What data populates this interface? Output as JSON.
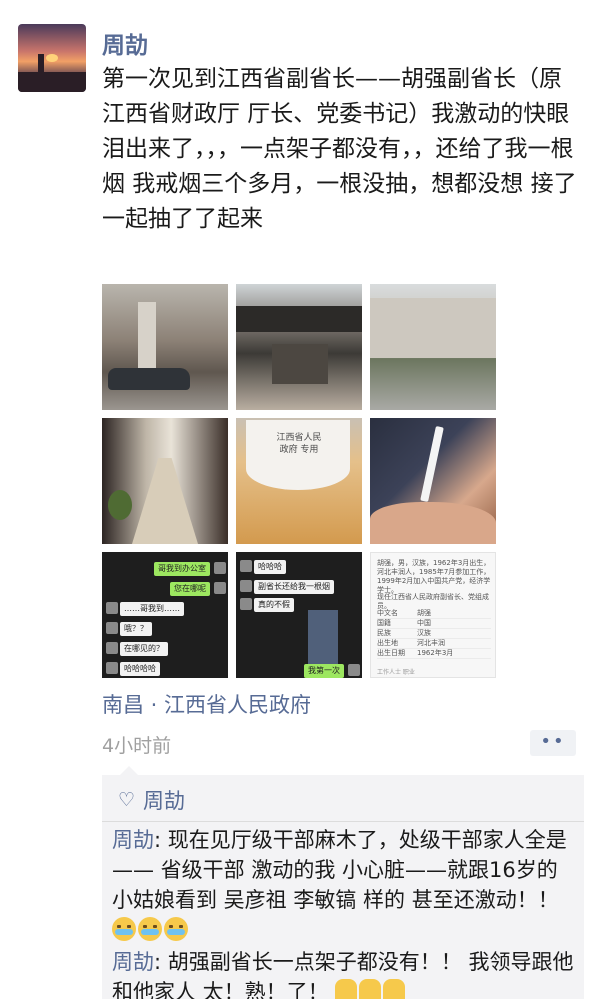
{
  "post": {
    "author": "周劼",
    "text": "第一次见到江西省副省长——胡强副省长（原江西省财政厅 厅长、党委书记）我激动的快眼泪出来了，，，一点架子都没有，，还给了我一根烟 我戒烟三个多月，一根没抽，想都没想 接了 一起抽了了起来",
    "location": "南昌 · 江西省人民政府",
    "time": "4小时前",
    "more_label": "••",
    "images": [
      {
        "name": "government-building-entrance-with-car"
      },
      {
        "name": "building-entrance-canopy"
      },
      {
        "name": "government-building-exterior"
      },
      {
        "name": "office-corridor"
      },
      {
        "name": "printed-paper-cup",
        "text": "江西省人民政府 专用"
      },
      {
        "name": "hand-holding-cigarette"
      },
      {
        "name": "chat-screenshot-1"
      },
      {
        "name": "chat-screenshot-2"
      },
      {
        "name": "official-profile-document"
      }
    ],
    "chat1": [
      {
        "side": "right",
        "text": "哥我到办公室",
        "color": "green"
      },
      {
        "side": "right",
        "text": "您在哪呢",
        "color": "green"
      },
      {
        "side": "left",
        "text": "……哥我到……",
        "color": "white"
      },
      {
        "side": "left",
        "text": "哦？？",
        "color": "white"
      },
      {
        "side": "left",
        "text": "在哪见的？",
        "color": "white"
      },
      {
        "side": "left",
        "text": "哈哈哈哈",
        "color": "white"
      }
    ],
    "chat2": [
      {
        "side": "left",
        "text": "哈哈哈",
        "color": "white"
      },
      {
        "side": "right",
        "text": "副省长还给我一根烟",
        "color": "green"
      },
      {
        "side": "left",
        "text": "真的不假",
        "color": "white"
      },
      {
        "side": "right",
        "text": "我第一次",
        "color": "green"
      }
    ],
    "doc": {
      "para1": "胡强，男，汉族，1962年3月出生，河北丰润人，1985年7月参加工作，1999年2月加入中国共产党，经济学学士。",
      "para2": "现任江西省人民政府副省长、党组成员。",
      "rows": [
        {
          "k": "中文名",
          "v": "胡强"
        },
        {
          "k": "国籍",
          "v": "中国"
        },
        {
          "k": "民族",
          "v": "汉族"
        },
        {
          "k": "出生地",
          "v": "河北丰润"
        },
        {
          "k": "出生日期",
          "v": "1962年3月"
        }
      ],
      "foot": "工作人士   职业"
    }
  },
  "comments": {
    "like_name": "周劼",
    "items": [
      {
        "author": "周劼",
        "separator": ": ",
        "text": "现在见厅级干部麻木了，处级干部家人全是—— 省级干部  激动的我  小心脏——就跟16岁的小姑娘看到 吴彦祖 李敏镐 样的   甚至还激动！！",
        "emoji": [
          "cry",
          "cry",
          "cry"
        ]
      },
      {
        "author": "周劼",
        "separator": ": ",
        "text": "胡强副省长一点架子都没有！！ 我领导跟他和他家人 太！熟！了！",
        "emoji": [
          "thumbs-up",
          "thumbs-up",
          "thumbs-up"
        ]
      }
    ]
  }
}
